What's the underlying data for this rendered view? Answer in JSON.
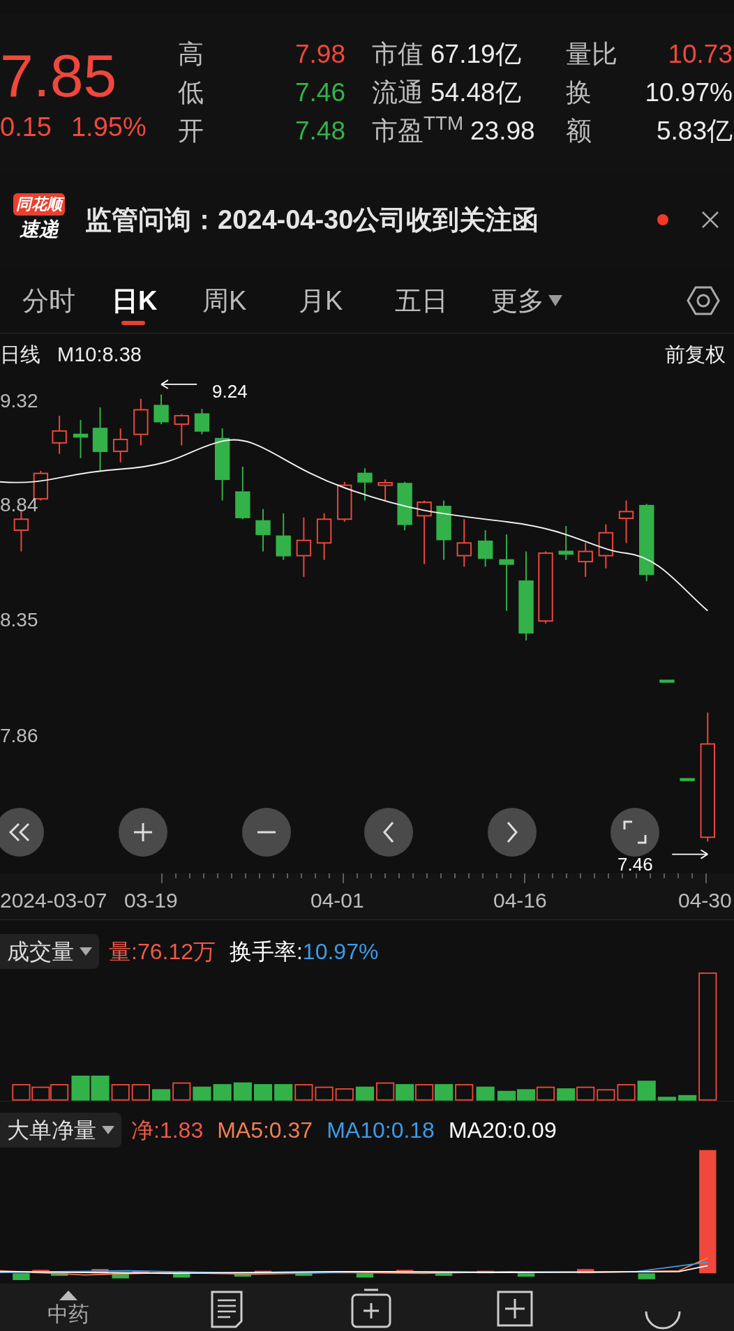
{
  "quote": {
    "price": "7.85",
    "change": "0.15",
    "change_pct": "1.95%",
    "color": "#f0483c",
    "stats": [
      {
        "label": "高",
        "value": "7.98",
        "color": "#f0483c"
      },
      {
        "label": "市值",
        "value": "67.19亿",
        "color": "#ededed"
      },
      {
        "label": "量比",
        "value": "10.73",
        "color": "#f0483c"
      },
      {
        "label": "低",
        "value": "7.46",
        "color": "#33b24a"
      },
      {
        "label": "流通",
        "value": "54.48亿",
        "color": "#ededed"
      },
      {
        "label": "换",
        "value": "10.97%",
        "color": "#ededed"
      },
      {
        "label": "开",
        "value": "7.48",
        "color": "#33b24a"
      },
      {
        "label": "市盈$^{TTM}$",
        "value": "23.98",
        "color": "#ededed"
      },
      {
        "label": "额",
        "value": "5.83亿",
        "color": "#ededed"
      }
    ]
  },
  "news": {
    "logo_top": "同花顺",
    "logo_bottom": "速递",
    "text": "监管问询：2024-04-30公司收到关注函",
    "unread": true
  },
  "tabs": [
    {
      "label": "分时",
      "selected": false,
      "kind": "plain"
    },
    {
      "label": "日K",
      "selected": true,
      "kind": "plain"
    },
    {
      "label": "周K",
      "selected": false,
      "kind": "plain"
    },
    {
      "label": "月K",
      "selected": false,
      "kind": "plain"
    },
    {
      "label": "五日",
      "selected": false,
      "kind": "plain"
    },
    {
      "label": "更多",
      "selected": false,
      "kind": "menu"
    }
  ],
  "chart_header": {
    "period": "日线",
    "ma": "M10:8.38",
    "adjust": "前复权"
  },
  "price_axis": [
    "9.32",
    "8.84",
    "8.35",
    "7.86"
  ],
  "high_marker": "9.24",
  "low_marker": "7.46",
  "dates": [
    "2024-03-07",
    "03-19",
    "04-01",
    "04-16",
    "04-30"
  ],
  "volume": {
    "indicator": "成交量",
    "readings": [
      {
        "text": "量:76.12万",
        "color": "#ee5a48"
      },
      {
        "text": "换手率:",
        "color": "#ffffff"
      },
      {
        "text": "10.97%",
        "color": "#3d9be9"
      }
    ]
  },
  "net": {
    "indicator": "大单净量",
    "readings": [
      {
        "text": "净:1.83",
        "color": "#ee5a48"
      },
      {
        "text": "MA5:0.37",
        "color": "#f07f55"
      },
      {
        "text": "MA10:0.18",
        "color": "#3d9be9"
      },
      {
        "text": "MA20:0.09",
        "color": "#ffffff"
      }
    ]
  },
  "bottom_nav": {
    "label": "中药"
  }
}
